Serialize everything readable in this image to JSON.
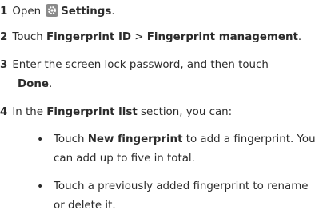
{
  "steps": [
    {
      "num": "1",
      "pre": "Open",
      "icon": "settings-gear-icon",
      "bold": "Settings",
      "post": "."
    },
    {
      "num": "2",
      "pre": "Touch ",
      "bold1": "Fingerprint ID",
      "mid": " > ",
      "bold2": "Fingerprint management",
      "post": "."
    },
    {
      "num": "3",
      "line1": "Enter the screen lock password, and then touch",
      "bold": "Done",
      "post": "."
    },
    {
      "num": "4",
      "pre": "In the ",
      "bold": "Fingerprint list",
      "post": " section, you can:"
    }
  ],
  "bullets": [
    {
      "pre": "Touch ",
      "bold": "New fingerprint",
      "post": " to add a fingerprint. You",
      "line2": "can add up to five in total."
    },
    {
      "line1": "Touch a previously added fingerprint to rename",
      "line2": "or delete it."
    }
  ],
  "bullet_glyph": "•",
  "icon_color": "#8a8a8a"
}
